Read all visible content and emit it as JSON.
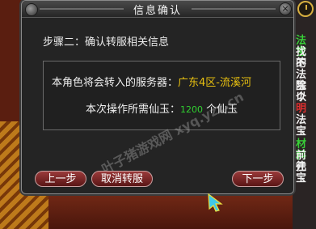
{
  "dialog": {
    "title": "信息确认",
    "close_label": "×",
    "step_label": "步骤二：确认转服相关信息",
    "server_row": {
      "label": "本角色将会转入的服务器：",
      "value": "广东4区-流溪河"
    },
    "cost_row": {
      "label": "本次操作所需仙玉：",
      "amount": "1200",
      "unit": "个仙玉"
    },
    "watermark": "叶子猪游戏网 xyq.yzz.cn",
    "buttons": {
      "prev": "上一步",
      "cancel": "取消转服",
      "next": "下一步"
    }
  },
  "side_panel": {
    "line1": "法宝",
    "line2": "找不",
    "line3": "的",
    "line4": "法宝",
    "line5": "除以",
    "line6": "个",
    "line7": "明",
    "line8": "法宝",
    "line9": "材料",
    "line10": "前往",
    "line11": "元宝"
  },
  "colors": {
    "dialog_bg": "#242424",
    "highlight_yellow": "#e8c010",
    "highlight_green": "#30d030",
    "button_red": "#7a2222"
  }
}
